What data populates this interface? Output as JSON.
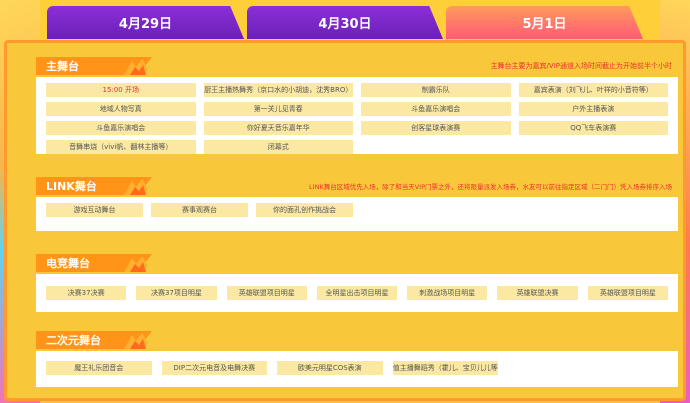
{
  "tabs": [
    {
      "label": "4月29日"
    },
    {
      "label": "4月30日"
    },
    {
      "label": "5月1日"
    }
  ],
  "sections": {
    "main": {
      "title": "主舞台",
      "note": "主舞台主要为嘉宾/VIP通道入场时间截止为开始前半个小时",
      "items": [
        "15:00 开场",
        "厨王主播热舞秀（京口水的小胡迪，沈秀BRO）",
        "制霸乐队",
        "嘉宾表演（刘飞儿、叶祥的小音符等）",
        "地域人物写真",
        "第一关儿见青春",
        "斗鱼嘉乐演唱会",
        "户外主播表演",
        "斗鱼嘉乐演唱会",
        "你好夏天音乐嘉年华",
        "创客星球表演赛",
        "QQ飞车表演赛",
        "音舞串烧（vivi帆、翻林主播等）",
        "闭幕式"
      ]
    },
    "link": {
      "title": "LINK舞台",
      "note": "LINK舞台区域优先入场，除了和当天VIP门票之外，还将限量派发入场券，水友可以前往指定区域（二门门）凭入场券排序入场",
      "items": [
        "游戏互动舞台",
        "赛事观赛台",
        "你的面孔创作挑战会"
      ]
    },
    "esports": {
      "title": "电竞舞台",
      "items": [
        "决赛37决赛",
        "决赛37项目明星",
        "英雄联盟项目明星",
        "全明星出击项目明星",
        "刺激战场项目明星",
        "英雄联盟决赛",
        "英雄联盟项目明星"
      ]
    },
    "acg": {
      "title": "二次元舞台",
      "items": [
        "魔王礼乐团音会",
        "DIP二次元电音及电舞决赛",
        "欧美元明星COS表演",
        "颜值主播舞蹈秀（霍儿、宝贝儿儿等）"
      ]
    }
  },
  "colors": {
    "tab_inactive": "#7a27c8",
    "tab_active": "#ff6e6a",
    "section_header": "#ff9419",
    "item_bg": "#fbe9a3",
    "note_red": "#e8312f"
  }
}
